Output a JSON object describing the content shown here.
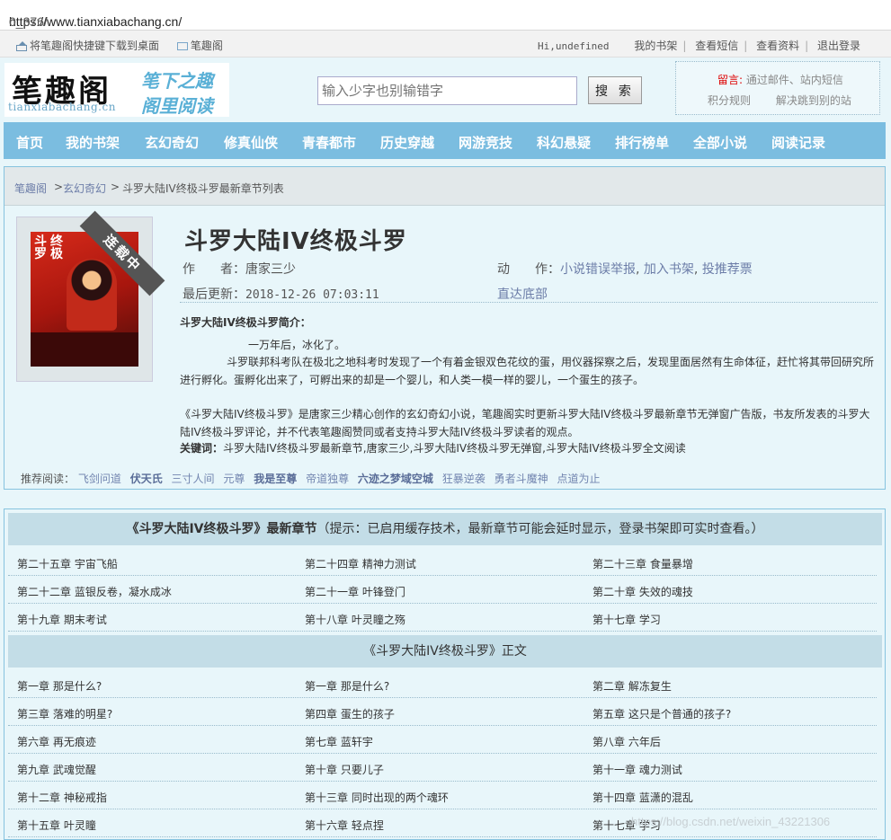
{
  "browser": {
    "url_prefix": "https://www.tianxiabachang.cn/",
    "url_path": "0_376/"
  },
  "toplinks": {
    "left": [
      "将笔趣阁快捷键下载到桌面",
      "笔趣阁"
    ],
    "greeting": "Hi,undefined",
    "right": [
      "我的书架",
      "查看短信",
      "查看资料",
      "退出登录"
    ]
  },
  "header": {
    "logo_text": "笔趣阁",
    "logo_domain": "tianxiabachang.cn",
    "slogan_1": "笔下之趣",
    "slogan_2": "阁里阅读",
    "search_placeholder": "输入少字也别输错字",
    "search_button": "搜 索",
    "notice_label": "留言:",
    "notice_text": "通过邮件、站内短信",
    "notice_links": [
      "积分规则",
      "解决跳到别的站"
    ]
  },
  "nav": [
    "首页",
    "我的书架",
    "玄幻奇幻",
    "修真仙侠",
    "青春都市",
    "历史穿越",
    "网游竞技",
    "科幻悬疑",
    "排行榜单",
    "全部小说",
    "阅读记录"
  ],
  "breadcrumb": {
    "home": "笔趣阁",
    "category": "玄幻奇幻",
    "current": "斗罗大陆IV终极斗罗最新章节列表"
  },
  "book": {
    "cover_badge": "连载中",
    "cover_title_1": "斗罗",
    "cover_title_2": "终极",
    "title": "斗罗大陆IV终极斗罗",
    "author_label": "作　　者：",
    "author": "唐家三少",
    "action_label": "动　　作：",
    "actions": [
      "小说错误举报",
      "加入书架",
      "投推荐票"
    ],
    "updated_label": "最后更新：",
    "updated": "2018-12-26 07:03:11",
    "bottom_link": "直达底部",
    "intro_title": "斗罗大陆IV终极斗罗简介：",
    "intro_line1": "一万年后，冰化了。",
    "intro_para": "斗罗联邦科考队在极北之地科考时发现了一个有着金银双色花纹的蛋，用仪器探察之后，发现里面居然有生命体征，赶忙将其带回研究所进行孵化。蛋孵化出来了，可孵出来的却是一个婴儿，和人类一模一样的婴儿，一个蛋生的孩子。",
    "desc": "《斗罗大陆IV终极斗罗》是唐家三少精心创作的玄幻奇幻小说，笔趣阁实时更新斗罗大陆IV终极斗罗最新章节无弹窗广告版，书友所发表的斗罗大陆IV终极斗罗评论，并不代表笔趣阁赞同或者支持斗罗大陆IV终极斗罗读者的观点。",
    "keywords_label": "关键词：",
    "keywords": "斗罗大陆IV终极斗罗最新章节,唐家三少,斗罗大陆IV终极斗罗无弹窗,斗罗大陆IV终极斗罗全文阅读"
  },
  "recommend": {
    "label": "推荐阅读：",
    "items": [
      "飞剑问道",
      "伏天氏",
      "三寸人间",
      "元尊",
      "我是至尊",
      "帝道独尊",
      "六迹之梦域空城",
      "狂暴逆袭",
      "勇者斗魔神",
      "点道为止"
    ]
  },
  "latest": {
    "title": "《斗罗大陆IV终极斗罗》最新章节",
    "hint": "（提示：已启用缓存技术，最新章节可能会延时显示，登录书架即可实时查看。）",
    "chapters": [
      "第二十五章 宇宙飞船",
      "第二十四章 精神力测试",
      "第二十三章 食量暴增",
      "第二十二章 蓝银反卷，凝水成冰",
      "第二十一章 叶锋登门",
      "第二十章 失效的魂技",
      "第十九章 期末考试",
      "第十八章 叶灵瞳之殇",
      "第十七章 学习"
    ]
  },
  "main": {
    "title": "《斗罗大陆IV终极斗罗》正文",
    "chapters": [
      "第一章 那是什么?",
      "第一章 那是什么?",
      "第二章 解冻复生",
      "第三章 落难的明星?",
      "第四章 蛋生的孩子",
      "第五章 这只是个普通的孩子?",
      "第六章 再无痕迹",
      "第七章 蓝轩宇",
      "第八章 六年后",
      "第九章 武魂觉醒",
      "第十章 只要儿子",
      "第十一章 魂力测试",
      "第十二章 神秘戒指",
      "第十三章 同时出现的两个魂环",
      "第十四章 蓝潇的混乱",
      "第十五章 叶灵瞳",
      "第十六章 轻点捏",
      "第十七章 学习"
    ]
  },
  "watermark": "https://blog.csdn.net/weixin_43221306"
}
